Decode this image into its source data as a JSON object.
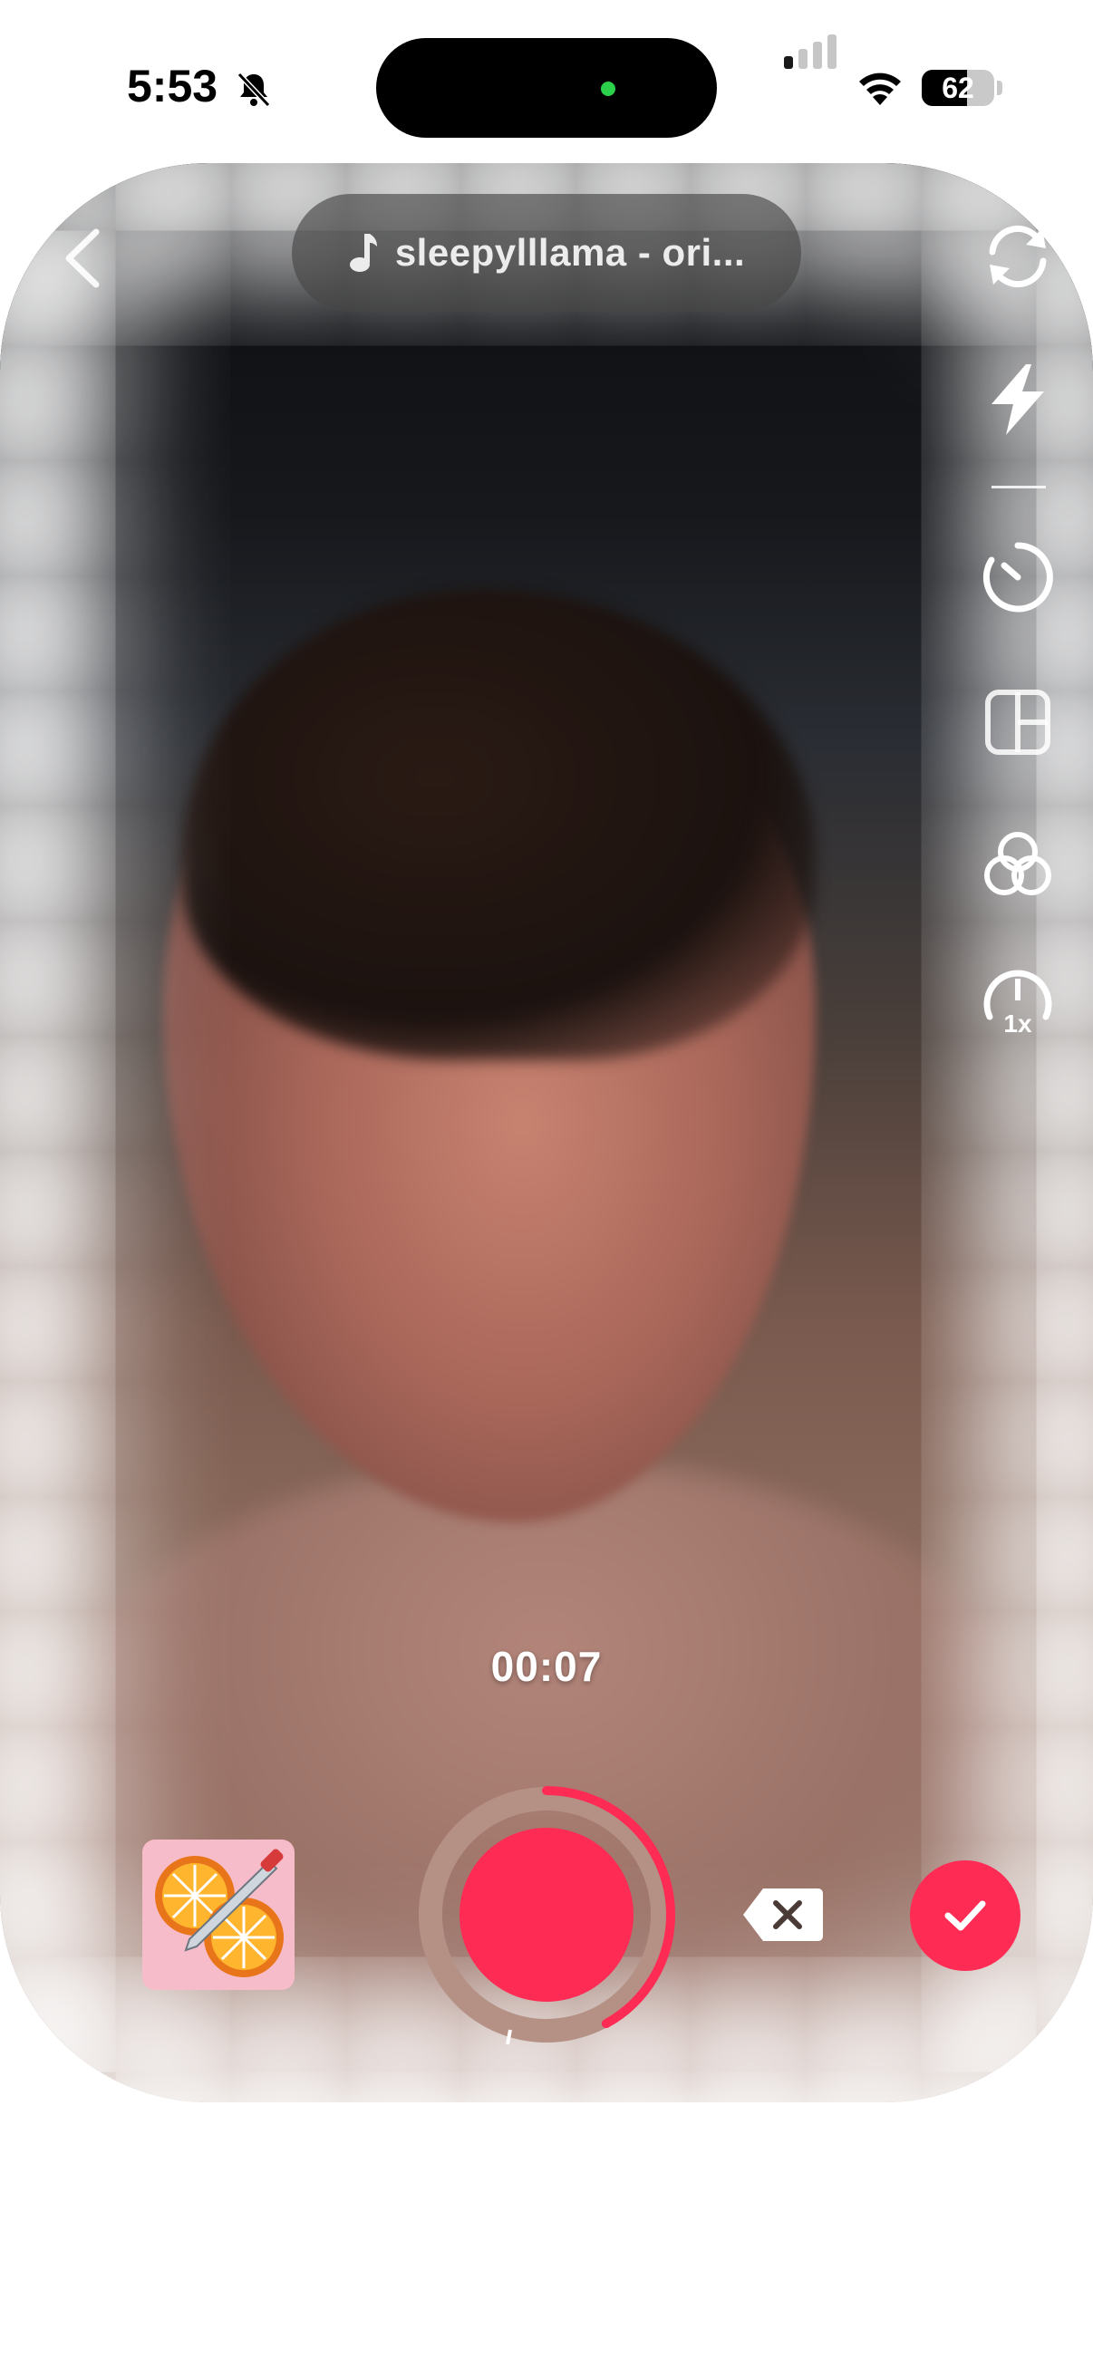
{
  "status_bar": {
    "time": "5:53",
    "battery_percent": "62",
    "battery_level": 0.62,
    "icons": [
      "bell-muted-icon",
      "cellular-signal-icon",
      "wifi-icon",
      "battery-icon"
    ]
  },
  "top_bar": {
    "back_icon": "chevron-left-icon",
    "sound_icon": "music-note-icon",
    "sound_label": "sleepylllama - ori..."
  },
  "side_tools": [
    {
      "name": "flip-camera",
      "icon": "flip-camera-icon"
    },
    {
      "name": "flash",
      "icon": "flash-icon"
    },
    {
      "name": "timer",
      "icon": "timer-icon"
    },
    {
      "name": "layout",
      "icon": "layout-grid-icon"
    },
    {
      "name": "filters",
      "icon": "filters-icon"
    },
    {
      "name": "speed",
      "icon": "speed-icon",
      "label": "1x"
    }
  ],
  "recording": {
    "elapsed": "00:07",
    "progress": 0.42
  },
  "bottom_bar": {
    "effect_icon": "orange-slice-effect-icon",
    "record_icon": "record-button-icon",
    "delete_icon": "delete-segment-icon",
    "confirm_icon": "checkmark-icon"
  },
  "colors": {
    "accent": "#fe2c55",
    "record_ring": "#b59185"
  }
}
